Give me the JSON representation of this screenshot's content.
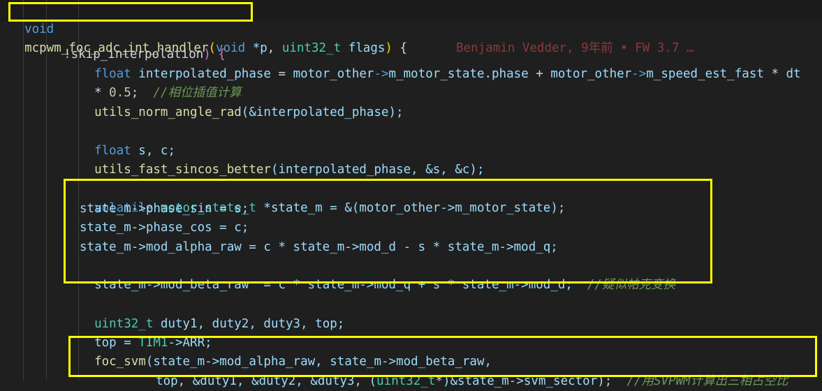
{
  "header": {
    "fn_decl_void": "void",
    "fn_name": "mcpwm_foc_adc_int_handler",
    "paren_open": "(",
    "param1_type": "void",
    "param1_name": " *p",
    "comma": ",",
    "param2_type": " uint32_t",
    "param2_name": " flags",
    "paren_close": ")",
    "brace": " {",
    "blame": "Benjamin Vedder, 9年前 • FW 3.7 …"
  },
  "lines": {
    "l2_a": "!skip_interpolation",
    "l2_b": ") {",
    "l3_kw": "float",
    "l3_var": " interpolated_phase",
    "l3_eq": " = ",
    "l3_a": "motor_other",
    "l3_arr1": "->",
    "l3_b": "m_motor_state",
    "l3_c": ".phase",
    "l3_plus": " + ",
    "l3_d": "motor_other",
    "l3_arr2": "->",
    "l3_e": "m_speed_est_fast",
    "l3_mul": " * ",
    "l3_f": "dt",
    "l4_op": "* ",
    "l4_num": "0.5",
    "l4_semi": ";  ",
    "l4_cm": "//相位插值计算",
    "l5_fn": "utils_norm_angle_rad",
    "l5_rest": "(&interpolated_phase);",
    "l7_kw": "float",
    "l7_rest": " s, c;",
    "l8_fn": "utils_fast_sincos_better",
    "l8_rest": "(interpolated_phase, &s, &c);",
    "l10_kw": "volatile",
    "l10_ty": " motor_state_t",
    "l10_rest": " *state_m = &(motor_other->m_motor_state);",
    "l11": "state_m->phase_sin = s;",
    "l12": "state_m->phase_cos = c;",
    "l13": "state_m->mod_alpha_raw = c * state_m->mod_d - s * state_m->mod_q;",
    "l14": "state_m->mod_beta_raw  = c * state_m->mod_q + s * state_m->mod_d;",
    "l14_cm": "  //疑似帕克变换",
    "l16_ty": "uint32_t",
    "l16_rest": " duty1, duty2, duty3, top;",
    "l17_a": "top = ",
    "l17_b": "TIM1",
    "l17_c": "->ARR;",
    "l18_fn": "foc_svm",
    "l18_rest": "(state_m->mod_alpha_raw, state_m->mod_beta_raw,",
    "l19_a": "top, &duty1, &duty2, &duty3, (",
    "l19_ty": "uint32_t",
    "l19_b": "*)&state_m->svm_sector);",
    "l19_cm": "  //用SVPWM计算出三相占空比"
  }
}
